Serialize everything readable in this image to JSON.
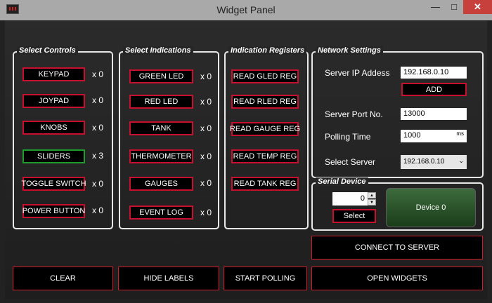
{
  "window": {
    "title": "Widget Panel",
    "minimize": "—",
    "maximize": "□",
    "close": "✕"
  },
  "select_controls": {
    "title": "Select Controls",
    "items": [
      {
        "label": "KEYPAD",
        "count": "x 0"
      },
      {
        "label": "JOYPAD",
        "count": "x 0"
      },
      {
        "label": "KNOBS",
        "count": "x 0"
      },
      {
        "label": "SLIDERS",
        "count": "x 3",
        "selected": true
      },
      {
        "label": "TOGGLE SWITCH",
        "count": "x 0"
      },
      {
        "label": "POWER BUTTON",
        "count": "x 0"
      }
    ]
  },
  "select_indications": {
    "title": "Select Indications",
    "items": [
      {
        "label": "GREEN LED",
        "count": "x 0"
      },
      {
        "label": "RED LED",
        "count": "x 0"
      },
      {
        "label": "TANK",
        "count": "x 0"
      },
      {
        "label": "THERMOMETER",
        "count": "x 0"
      },
      {
        "label": "GAUGES",
        "count": "x 0"
      },
      {
        "label": "EVENT LOG",
        "count": "x 0"
      }
    ]
  },
  "indication_registers": {
    "title": "Indication Registers",
    "items": [
      "READ GLED REG",
      "READ RLED REG",
      "READ GAUGE REG",
      "READ TEMP REG",
      "READ TANK REG"
    ]
  },
  "network": {
    "title": "Network Settings",
    "server_ip_label": "Server IP Addess",
    "server_ip_value": "192.168.0.10",
    "add_label": "ADD",
    "port_label": "Server Port  No.",
    "port_value": "13000",
    "polling_label": "Polling Time",
    "polling_value": "1000",
    "polling_unit": "ms",
    "select_server_label": "Select Server",
    "select_server_value": "192.168.0.10"
  },
  "serial": {
    "title": "Serial Device",
    "spin_value": "0",
    "up": "▲",
    "down": "▼",
    "select_label": "Select",
    "device_label": "Device 0"
  },
  "actions": {
    "connect": "CONNECT TO SERVER",
    "clear": "CLEAR",
    "hide_labels": "HIDE LABELS",
    "start_polling": "START POLLING",
    "open_widgets": "OPEN WIDGETS"
  },
  "colors": {
    "accent_red": "#c8102e",
    "selected_green": "#1f9b2b",
    "close_red": "#c7403b"
  }
}
